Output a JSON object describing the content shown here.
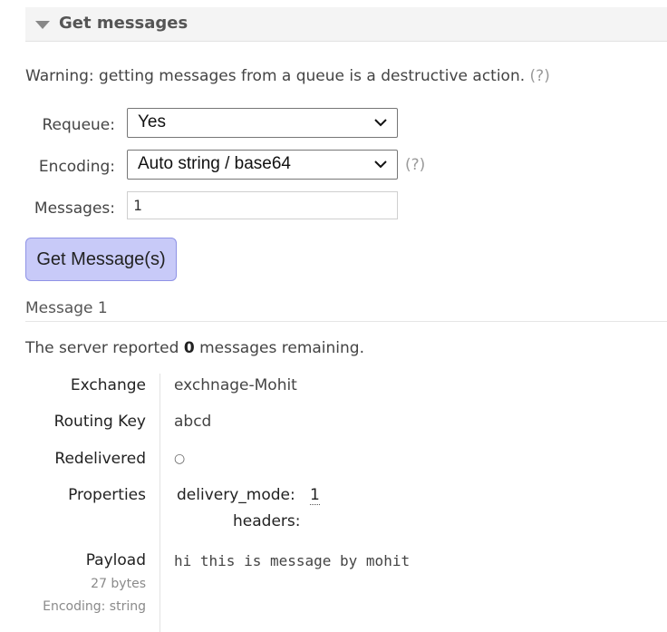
{
  "section": {
    "title": "Get messages"
  },
  "warning": {
    "text": "Warning: getting messages from a queue is a destructive action.",
    "help": "(?)"
  },
  "form": {
    "requeue_label": "Requeue:",
    "requeue_value": "Yes",
    "encoding_label": "Encoding:",
    "encoding_value": "Auto string / base64",
    "encoding_help": "(?)",
    "messages_label": "Messages:",
    "messages_value": "1",
    "button": "Get Message(s)"
  },
  "message": {
    "heading": "Message 1",
    "remaining_prefix": "The server reported",
    "remaining_count": "0",
    "remaining_suffix": "messages remaining.",
    "exchange_label": "Exchange",
    "exchange_value": "exchnage-Mohit",
    "routing_key_label": "Routing Key",
    "routing_key_value": "abcd",
    "redelivered_label": "Redelivered",
    "redelivered_value": "○",
    "properties_label": "Properties",
    "properties": {
      "delivery_mode_key": "delivery_mode:",
      "delivery_mode_value": "1",
      "headers_key": "headers:"
    },
    "payload_label": "Payload",
    "payload_size": "27 bytes",
    "payload_encoding": "Encoding: string",
    "payload_value": "hi this is message by mohit"
  },
  "colors": {
    "button_bg": "#c8caf8",
    "button_border": "#8f93e6",
    "header_bg": "#f4f4f4"
  },
  "icons": {
    "collapse": "triangle-down-icon",
    "select": "chevron-down-icon"
  }
}
